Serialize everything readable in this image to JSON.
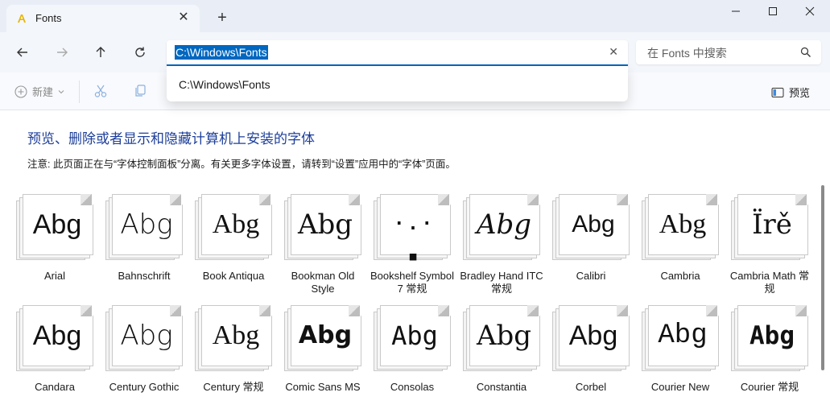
{
  "window": {
    "tab_title": "Fonts",
    "tab_close": "✕",
    "new_tab": "+"
  },
  "nav": {
    "address_value": "C:\\Windows\\Fonts",
    "address_clear": "✕",
    "search_placeholder": "在 Fonts 中搜索"
  },
  "dropdown": {
    "item": "C:\\Windows\\Fonts"
  },
  "commandbar": {
    "new_label": "新建",
    "preview_label": "预览"
  },
  "content": {
    "heading": "预览、删除或者显示和隐藏计算机上安装的字体",
    "note": "注意: 此页面正在与“字体控制面板”分离。有关更多字体设置，请转到“设置”应用中的“字体”页面。"
  },
  "fonts": [
    {
      "name": "Arial",
      "sample": "Abg"
    },
    {
      "name": "Bahnschrift",
      "sample": "Abg"
    },
    {
      "name": "Book Antiqua",
      "sample": "Abg"
    },
    {
      "name": "Bookman Old Style",
      "sample": "Abg"
    },
    {
      "name": "Bookshelf Symbol 7 常规",
      "sample": "·.·  ▪"
    },
    {
      "name": "Bradley Hand ITC 常规",
      "sample": "Abg"
    },
    {
      "name": "Calibri",
      "sample": "Abg"
    },
    {
      "name": "Cambria",
      "sample": "Abg"
    },
    {
      "name": "Cambria Math 常规",
      "sample": "Ïrě"
    },
    {
      "name": "Candara",
      "sample": "Abg"
    },
    {
      "name": "Century Gothic",
      "sample": "Abg"
    },
    {
      "name": "Century 常规",
      "sample": "Abg"
    },
    {
      "name": "Comic Sans MS",
      "sample": "Abg"
    },
    {
      "name": "Consolas",
      "sample": "Abg"
    },
    {
      "name": "Constantia",
      "sample": "Abg"
    },
    {
      "name": "Corbel",
      "sample": "Abg"
    },
    {
      "name": "Courier New",
      "sample": "Abg"
    },
    {
      "name": "Courier 常规",
      "sample": "Abg"
    }
  ]
}
